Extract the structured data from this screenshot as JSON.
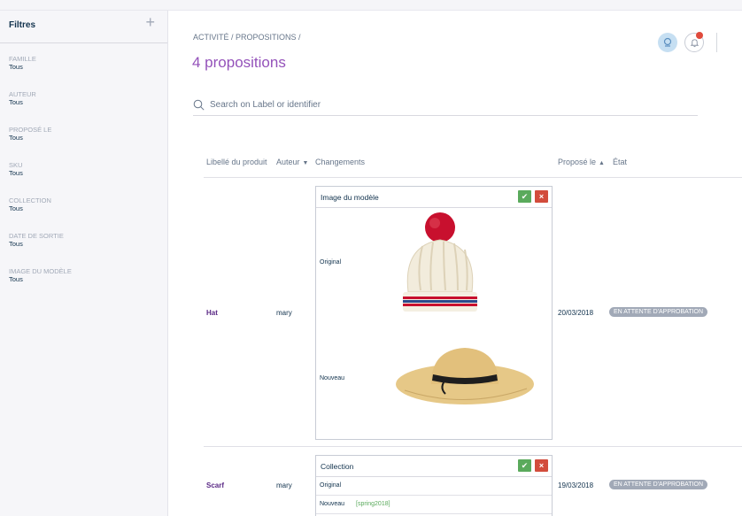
{
  "sidebar": {
    "title": "Filtres",
    "add_icon": "plus-icon",
    "filters": [
      {
        "label": "FAMILLE",
        "value": "Tous"
      },
      {
        "label": "AUTEUR",
        "value": "Tous"
      },
      {
        "label": "PROPOSÉ LE",
        "value": "Tous"
      },
      {
        "label": "SKU",
        "value": "Tous"
      },
      {
        "label": "COLLECTION",
        "value": "Tous"
      },
      {
        "label": "DATE DE SORTIE",
        "value": "Tous"
      },
      {
        "label": "IMAGE DU MODÈLE",
        "value": "Tous"
      }
    ]
  },
  "header": {
    "breadcrumb": "ACTIVITÉ / PROPOSITIONS /",
    "title": "4 propositions"
  },
  "search": {
    "placeholder": "Search on Label or identifier",
    "value": ""
  },
  "table": {
    "columns": {
      "product": "Libellé du produit",
      "author": "Auteur",
      "changes": "Changements",
      "proposed": "Proposé le",
      "state": "État"
    },
    "rows": [
      {
        "product": "Hat",
        "author": "mary",
        "change_title": "Image du modèle",
        "original_label": "Original",
        "new_label": "Nouveau",
        "original_image": "wool beanie with red pompom",
        "new_image": "straw sun hat with black ribbon",
        "date": "20/03/2018",
        "status": "EN ATTENTE D'APPROBATION"
      },
      {
        "product": "Scarf",
        "author": "mary",
        "change_title": "Collection",
        "original_label": "Original",
        "new_label": "Nouveau",
        "new_value": "[spring2018]",
        "date": "19/03/2018",
        "status": "EN ATTENTE D'APPROBATION"
      }
    ]
  },
  "colors": {
    "accent": "#9452ba",
    "approve": "#5aaa5c",
    "reject": "#d24c3c",
    "badge": "#a1a9b7"
  }
}
